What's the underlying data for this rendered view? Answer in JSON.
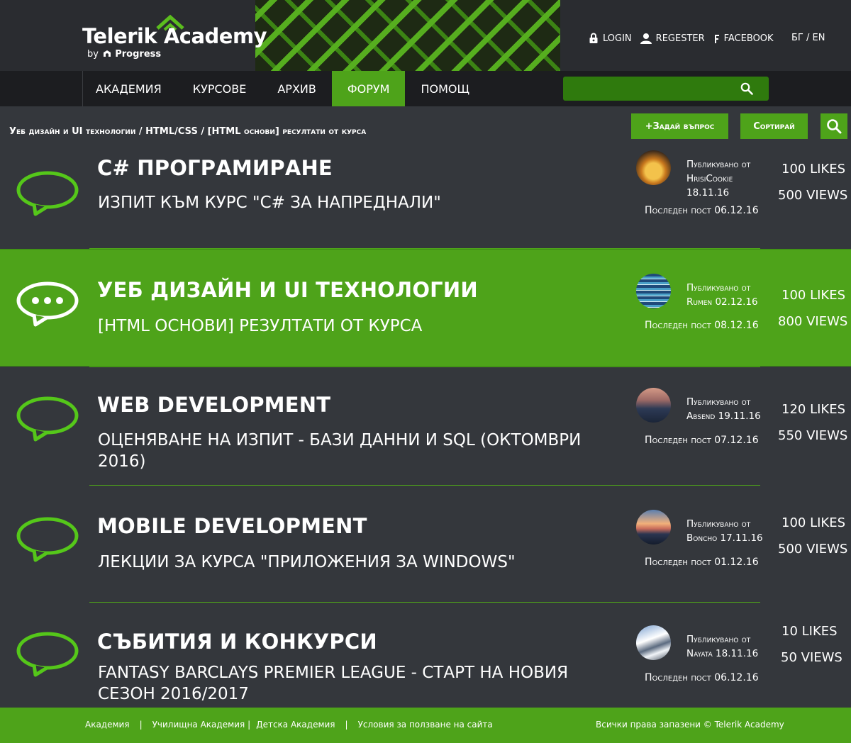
{
  "header": {
    "logo_text": "Telerik Academy",
    "logo_by": "by",
    "logo_vendor": "Progress",
    "links": [
      {
        "label": "LOGIN",
        "icon": "lock-icon"
      },
      {
        "label": "REGESTER",
        "icon": "user-icon"
      },
      {
        "label": "FACEBOOK",
        "icon": "facebook-icon"
      }
    ],
    "language": "БГ / EN"
  },
  "nav": {
    "items": [
      {
        "label": "АКАДЕМИЯ",
        "active": false
      },
      {
        "label": "КУРСОВЕ",
        "active": false
      },
      {
        "label": "АРХИВ",
        "active": false
      },
      {
        "label": "ФОРУМ",
        "active": true
      },
      {
        "label": "ПОМОЩ",
        "active": false
      }
    ],
    "search_value": ""
  },
  "breadcrumb": "Уеб дизайн и UI технологии / HTML/CSS / [HTML основи] ресултати от курса",
  "actions": {
    "ask": "+Задай въпрос",
    "sort": "Сортирай"
  },
  "topics": [
    {
      "category": "C# ПРОГРАМИРАНЕ",
      "title": "Изпит към курс \"C# за напреднали\"",
      "posted_line1": "Публикувано от",
      "posted_line2": "HrisiCookie",
      "posted_line3": "18.11.16",
      "last_post": "Последен пост 06.12.16",
      "likes": "100 LIKES",
      "views": "500 VIEWS",
      "highlighted": false,
      "bubble": "speech-bubble-icon"
    },
    {
      "category": "УЕБ ДИЗАЙН И UI ТЕХНОЛОГИИ",
      "title": "[HTML основи] резултати от курса",
      "posted_line1": "Публикувано от",
      "posted_line2": "Rumen 02.12.16",
      "posted_line3": "",
      "last_post": "Последен пост 08.12.16",
      "likes": "100 LIKES",
      "views": "800 VIEWS",
      "highlighted": true,
      "bubble": "speech-bubble-dots-icon"
    },
    {
      "category": "WEB DEVELOPMENT",
      "title": "Оценяване на изпит - Бази данни и SQL (Октомври 2016)",
      "posted_line1": "Публикувано от",
      "posted_line2": "Absend 19.11.16",
      "posted_line3": "",
      "last_post": "Последен пост 07.12.16",
      "likes": "120 LIKES",
      "views": "550 VIEWS",
      "highlighted": false,
      "bubble": "speech-bubble-icon"
    },
    {
      "category": "MOBILE DEVELOPMENT",
      "title": "Лекции за курса \"Приложения за Windows\"",
      "posted_line1": "Публикувано от",
      "posted_line2": "Boncho 17.11.16",
      "posted_line3": "",
      "last_post": "Последен пост 01.12.16",
      "likes": "100 LIKES",
      "views": "500 VIEWS",
      "highlighted": false,
      "bubble": "speech-bubble-icon"
    },
    {
      "category": "СЪБИТИЯ И КОНКУРСИ",
      "title": "Fantasy Barclays Premier League - старт на новия сезон 2016/2017",
      "posted_line1": "Публикувано от",
      "posted_line2": "Nayata 18.11.16",
      "posted_line3": "",
      "last_post": "Последен пост 06.12.16",
      "likes": "10 LIKES",
      "views": "50 VIEWS",
      "highlighted": false,
      "bubble": "speech-bubble-icon"
    }
  ],
  "footer": {
    "links": [
      "Академия",
      "Училищна Академия",
      "Детска Академия",
      "Условия за ползване на сайта"
    ],
    "separator": "|",
    "copyright": "Всички права запазени  ©  Telerik Academy"
  },
  "colors": {
    "accent": "#4ea31a",
    "background": "#34373c",
    "header": "#2a2c30",
    "nav": "#1c1d20"
  }
}
